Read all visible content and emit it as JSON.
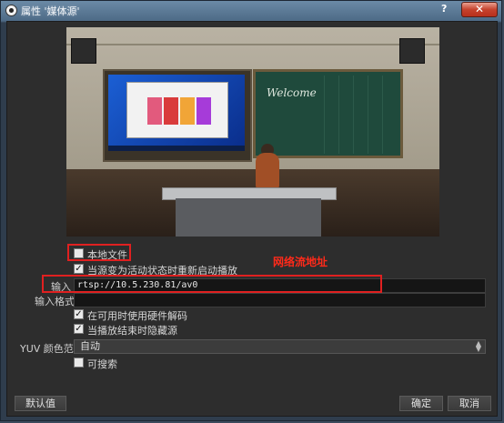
{
  "window": {
    "title": "属性 '媒体源'",
    "help": "?",
    "close": "✕"
  },
  "preview": {
    "board_text": "Welcome"
  },
  "form": {
    "local_file": {
      "label": "本地文件",
      "checked": false
    },
    "restart_on_activate": {
      "label": "当源变为活动状态时重新启动播放",
      "checked": true
    },
    "input": {
      "label": "输入",
      "value": "rtsp://10.5.230.81/av0"
    },
    "input_format": {
      "label": "输入格式",
      "value": ""
    },
    "hw_decode": {
      "label": "在可用时使用硬件解码",
      "checked": true
    },
    "hide_when_ended": {
      "label": "当播放结束时隐藏源",
      "checked": true
    },
    "yuv_range": {
      "label": "YUV 颜色范围",
      "value": "自动"
    },
    "seekable": {
      "label": "可搜索",
      "checked": false
    }
  },
  "annotation": {
    "text": "网络流地址",
    "color": "#ff2a1a"
  },
  "buttons": {
    "defaults": "默认值",
    "ok": "确定",
    "cancel": "取消"
  }
}
